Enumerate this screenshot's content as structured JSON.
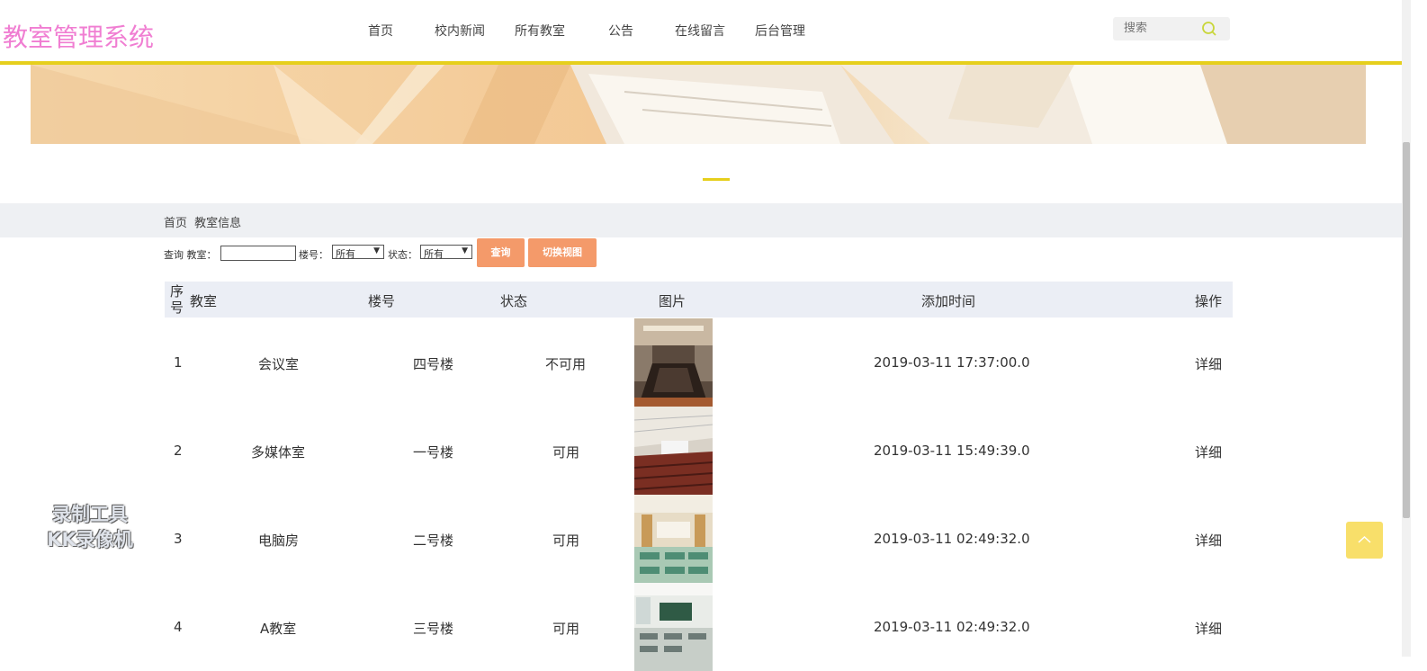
{
  "header": {
    "logo": "教室管理系统",
    "nav": [
      "首页",
      "校内新闻",
      "所有教室",
      "公告",
      "在线留言",
      "后台管理"
    ],
    "search_placeholder": "搜索"
  },
  "breadcrumb": [
    "首页",
    "教室信息"
  ],
  "filter": {
    "query_label": "查询 教室：",
    "building_label": "楼号：",
    "building_value": "所有",
    "status_label": "状态：",
    "status_value": "所有",
    "query_button": "查询",
    "switch_button": "切换视图"
  },
  "table": {
    "columns": [
      "序号",
      "教室",
      "楼号",
      "状态",
      "图片",
      "添加时间",
      "操作"
    ],
    "rows": [
      {
        "no": "1",
        "room": "会议室",
        "building": "四号楼",
        "status": "不可用",
        "time": "2019-03-11 17:37:00.0",
        "action": "详细"
      },
      {
        "no": "2",
        "room": "多媒体室",
        "building": "一号楼",
        "status": "可用",
        "time": "2019-03-11 15:49:39.0",
        "action": "详细"
      },
      {
        "no": "3",
        "room": "电脑房",
        "building": "二号楼",
        "status": "可用",
        "time": "2019-03-11 02:49:32.0",
        "action": "详细"
      },
      {
        "no": "4",
        "room": "A教室",
        "building": "三号楼",
        "status": "可用",
        "time": "2019-03-11 02:49:32.0",
        "action": "详细"
      }
    ]
  },
  "watermark": {
    "line1": "录制工具",
    "line2": "KK录像机"
  },
  "icons": {
    "search": "search-icon",
    "back_to_top": "arrow-up-icon"
  },
  "colors": {
    "accent": "#e6cf1c",
    "logo": "#f07ed2",
    "button": "#f49a6a",
    "float": "#f8df6a"
  }
}
